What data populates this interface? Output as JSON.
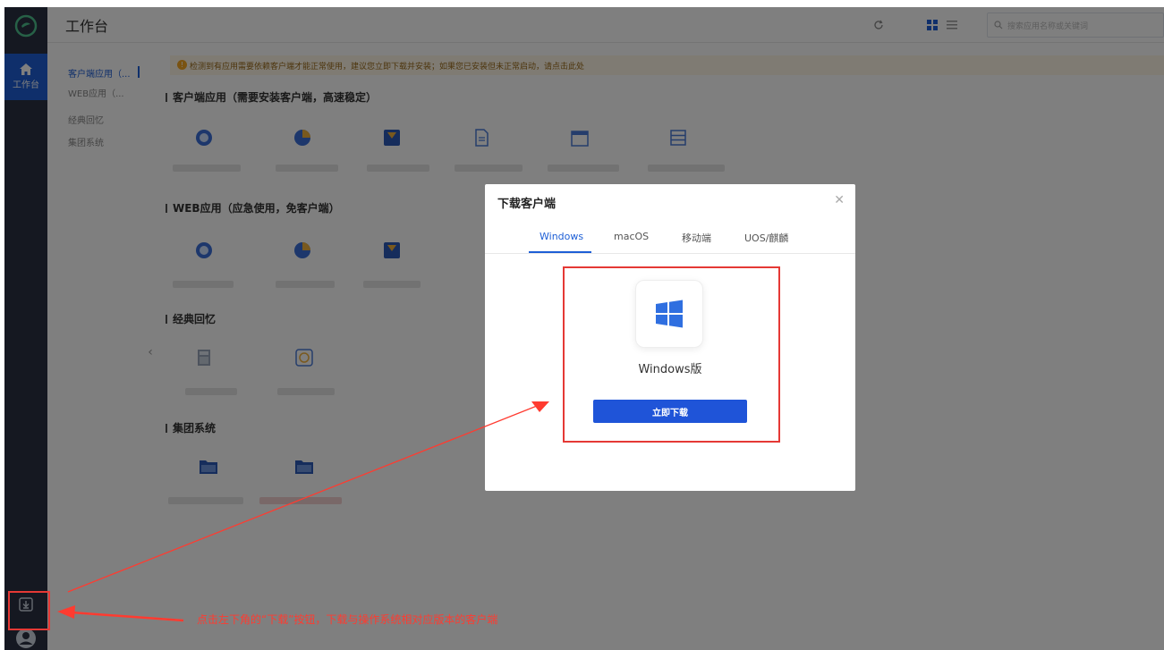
{
  "header": {
    "title": "工作台",
    "search_placeholder": "搜索应用名称或关键词"
  },
  "nav": {
    "home_label": "工作台"
  },
  "categories": [
    {
      "label": "客户端应用（...",
      "active": true
    },
    {
      "label": "WEB应用（...",
      "active": false
    },
    {
      "label": "经典回忆",
      "active": false
    },
    {
      "label": "集团系统",
      "active": false
    }
  ],
  "notice": "检测到有应用需要依赖客户端才能正常使用，建议您立即下载并安装；如果您已安装但未正常启动，请点击此处",
  "sections": [
    {
      "title": "客户端应用（需要安装客户端，高速稳定）"
    },
    {
      "title": "WEB应用（应急使用，免客户端）"
    },
    {
      "title": "经典回忆"
    },
    {
      "title": "集团系统"
    }
  ],
  "modal": {
    "title": "下载客户端",
    "tabs": [
      "Windows",
      "macOS",
      "移动端",
      "UOS/麒麟"
    ],
    "active_tab": "Windows",
    "os_name": "Windows版",
    "download_button": "立即下载"
  },
  "annotation": {
    "text": "点击左下角的“下载”按钮，下载与操作系统相对应版本的客户端"
  },
  "colors": {
    "nav_bg": "#2a3142",
    "accent": "#1e5fd6",
    "annotation_red": "#e53935"
  }
}
